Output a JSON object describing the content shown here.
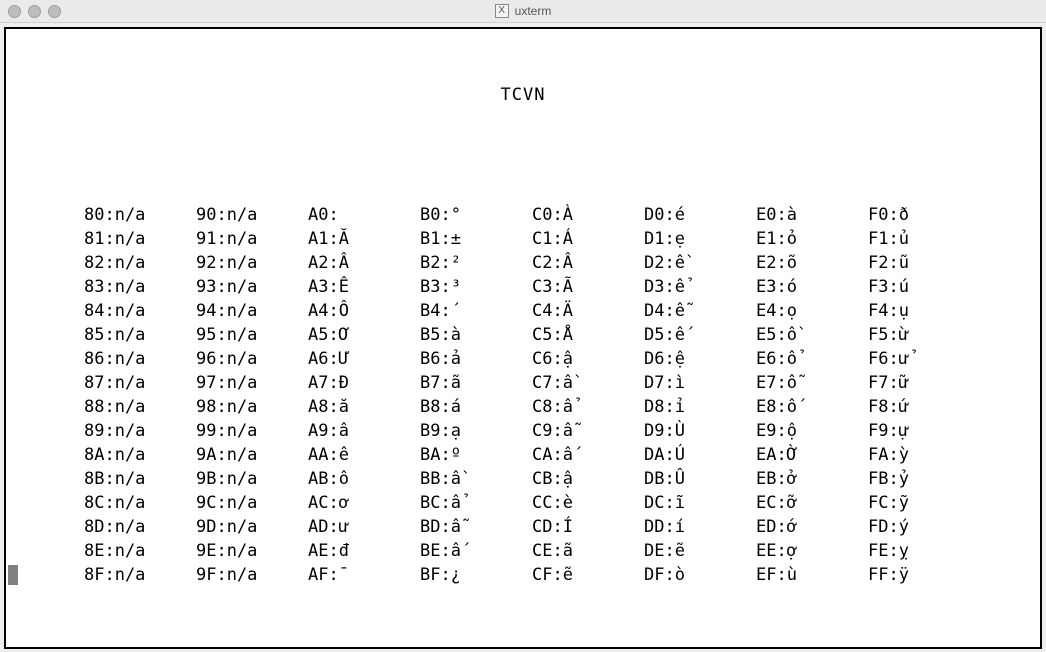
{
  "window": {
    "title": "uxterm"
  },
  "heading": "TCVN",
  "columns": [
    {
      "keys": [
        "80",
        "81",
        "82",
        "83",
        "84",
        "85",
        "86",
        "87",
        "88",
        "89",
        "8A",
        "8B",
        "8C",
        "8D",
        "8E",
        "8F"
      ],
      "vals": [
        "n/a",
        "n/a",
        "n/a",
        "n/a",
        "n/a",
        "n/a",
        "n/a",
        "n/a",
        "n/a",
        "n/a",
        "n/a",
        "n/a",
        "n/a",
        "n/a",
        "n/a",
        "n/a"
      ]
    },
    {
      "keys": [
        "90",
        "91",
        "92",
        "93",
        "94",
        "95",
        "96",
        "97",
        "98",
        "99",
        "9A",
        "9B",
        "9C",
        "9D",
        "9E",
        "9F"
      ],
      "vals": [
        "n/a",
        "n/a",
        "n/a",
        "n/a",
        "n/a",
        "n/a",
        "n/a",
        "n/a",
        "n/a",
        "n/a",
        "n/a",
        "n/a",
        "n/a",
        "n/a",
        "n/a",
        "n/a"
      ]
    },
    {
      "keys": [
        "A0",
        "A1",
        "A2",
        "A3",
        "A4",
        "A5",
        "A6",
        "A7",
        "A8",
        "A9",
        "AA",
        "AB",
        "AC",
        "AD",
        "AE",
        "AF"
      ],
      "vals": [
        "",
        "Ă",
        "Â",
        "Ê",
        "Ô",
        "Ơ",
        "Ư",
        "Đ",
        "ă",
        "â",
        "ê",
        "ô",
        "ơ",
        "ư",
        "đ",
        "¯"
      ]
    },
    {
      "keys": [
        "B0",
        "B1",
        "B2",
        "B3",
        "B4",
        "B5",
        "B6",
        "B7",
        "B8",
        "B9",
        "BA",
        "BB",
        "BC",
        "BD",
        "BE",
        "BF"
      ],
      "vals": [
        "°",
        "±",
        "²",
        "³",
        "´",
        "à",
        "ả",
        "ã",
        "á",
        "ạ",
        "º",
        "ầ",
        "ẩ",
        "ẫ",
        "ấ",
        "¿"
      ]
    },
    {
      "keys": [
        "C0",
        "C1",
        "C2",
        "C3",
        "C4",
        "C5",
        "C6",
        "C7",
        "C8",
        "C9",
        "CA",
        "CB",
        "CC",
        "CD",
        "CE",
        "CF"
      ],
      "vals": [
        "À",
        "Á",
        "Â",
        "Ã",
        "Ä",
        "Å",
        "ậ",
        "ầ",
        "ẩ",
        "ẫ",
        "ấ",
        "ậ",
        "è",
        "Í",
        "ã",
        "ẽ"
      ]
    },
    {
      "keys": [
        "D0",
        "D1",
        "D2",
        "D3",
        "D4",
        "D5",
        "D6",
        "D7",
        "D8",
        "D9",
        "DA",
        "DB",
        "DC",
        "DD",
        "DE",
        "DF"
      ],
      "vals": [
        "é",
        "ẹ",
        "ề",
        "ể",
        "ễ",
        "ế",
        "ệ",
        "ì",
        "ỉ",
        "Ù",
        "Ú",
        "Û",
        "ĩ",
        "í",
        "ẽ",
        "ò"
      ]
    },
    {
      "keys": [
        "E0",
        "E1",
        "E2",
        "E3",
        "E4",
        "E5",
        "E6",
        "E7",
        "E8",
        "E9",
        "EA",
        "EB",
        "EC",
        "ED",
        "EE",
        "EF"
      ],
      "vals": [
        "à",
        "ỏ",
        "õ",
        "ó",
        "ọ",
        "ồ",
        "ổ",
        "ỗ",
        "ố",
        "ộ",
        "Ờ",
        "ở",
        "ỡ",
        "ớ",
        "ợ",
        "ù"
      ]
    },
    {
      "keys": [
        "F0",
        "F1",
        "F2",
        "F3",
        "F4",
        "F5",
        "F6",
        "F7",
        "F8",
        "F9",
        "FA",
        "FB",
        "FC",
        "FD",
        "FE",
        "FF"
      ],
      "vals": [
        "ð",
        "ủ",
        "ũ",
        "ú",
        "ụ",
        "ừ",
        "ử",
        "ữ",
        "ứ",
        "ự",
        "ỳ",
        "ỷ",
        "ỹ",
        "ý",
        "ỵ",
        "ÿ"
      ]
    }
  ]
}
